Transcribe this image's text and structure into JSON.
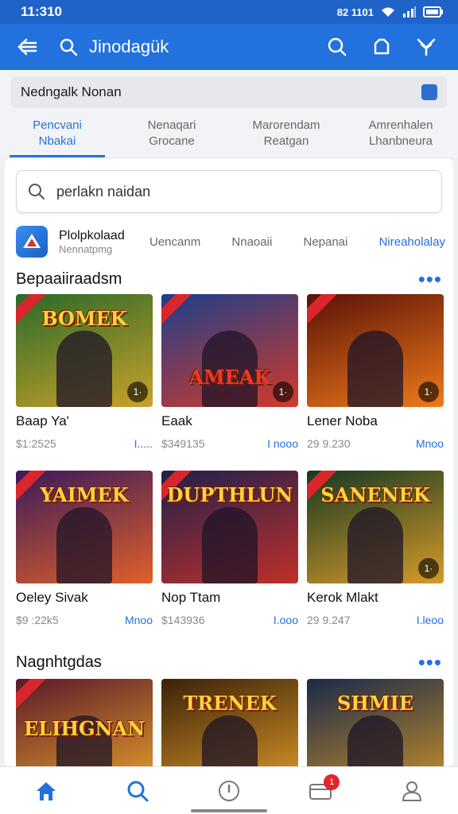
{
  "status": {
    "time": "11:310",
    "right_text": "82 1101"
  },
  "appbar": {
    "title": "Jinodagük"
  },
  "account": {
    "name": "Nedngalk Nonan"
  },
  "tabs": [
    {
      "l1": "Pencvani",
      "l2": "Nbakai"
    },
    {
      "l1": "Nenaqari",
      "l2": "Grocane"
    },
    {
      "l1": "Marorendam",
      "l2": "Reatgan"
    },
    {
      "l1": "Amrenhalen",
      "l2": "Lhanbneura"
    }
  ],
  "search": {
    "placeholder": "perlakn naidan"
  },
  "store": {
    "name": "Plolpkolaad",
    "subtitle": "Nennatpmg",
    "filters": [
      "Uencanm",
      "Nnaoaii",
      "Nepanai",
      "Nireaholalay"
    ]
  },
  "sections": [
    {
      "title": "Bepaaiiraadsm",
      "more": "•••",
      "cards": [
        {
          "title": "Baap Ya'",
          "price": "$1:2525",
          "more": "I.....",
          "logo": "BOMEK",
          "badge": "1·",
          "bg": [
            "#2b6a2a",
            "#c9a12a"
          ]
        },
        {
          "title": "Eaak",
          "price": "$349135",
          "more": "I nooo",
          "logo": "AMEAK",
          "badge": "1·",
          "bg": [
            "#1d3f8a",
            "#d23a2a"
          ]
        },
        {
          "title": "Lener Noba",
          "price": "29 9.230",
          "more": "Mnoo",
          "logo": "",
          "badge": "1·",
          "bg": [
            "#5a1208",
            "#f07a1a"
          ]
        }
      ]
    },
    {
      "cards": [
        {
          "title": "Oeley Sivak",
          "price": "$9 :22k5",
          "more": "Mnoo",
          "logo": "YAIMEK",
          "badge": "",
          "bg": [
            "#3b1a5a",
            "#e0602a"
          ]
        },
        {
          "title": "Nop Ttam",
          "price": "$143936",
          "more": "I.ooo",
          "logo": "DUPTHLUN",
          "badge": "",
          "bg": [
            "#20204a",
            "#c0302a"
          ]
        },
        {
          "title": "Kerok Mlakt",
          "price": "29 9.247",
          "more": "I.leoo",
          "logo": "SANENEK",
          "badge": "1·",
          "bg": [
            "#163a22",
            "#d89a2a"
          ]
        }
      ]
    },
    {
      "title": "Nagnhtgdas",
      "more": "•••",
      "cards": [
        {
          "title": "",
          "price": "",
          "more": "",
          "logo": "ELIHGNAN",
          "badge": "",
          "bg": [
            "#5a1a2a",
            "#e8a02a"
          ]
        },
        {
          "title": "",
          "price": "",
          "more": "",
          "logo": "TRENEK",
          "badge": "",
          "bg": [
            "#3a2208",
            "#e09a2a"
          ]
        },
        {
          "title": "",
          "price": "",
          "more": "",
          "logo": "SHMIE",
          "badge": "",
          "bg": [
            "#1a2a4a",
            "#c8902a"
          ]
        }
      ]
    }
  ],
  "nav": {
    "notif_count": "1"
  },
  "colors": {
    "primary": "#2371dc",
    "status_bar": "#1f63c8",
    "badge": "#e0262c"
  }
}
